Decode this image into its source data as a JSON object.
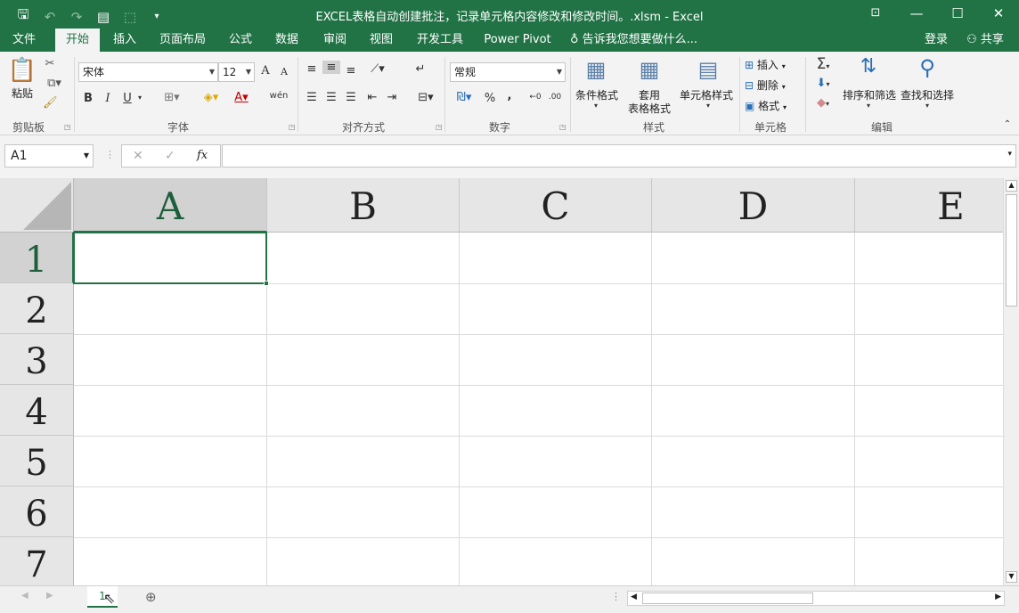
{
  "window": {
    "title": "EXCEL表格自动创建批注，记录单元格内容修改和修改时间。.xlsm - Excel",
    "save_icon": "save-icon",
    "undo_icon": "undo-icon",
    "redo_icon": "redo-icon",
    "ribbon_display_icon": "ribbon-display-icon",
    "minimize_icon": "minimize-icon",
    "maximize_icon": "maximize-icon",
    "close_icon": "close-icon"
  },
  "menu": {
    "tabs": [
      "文件",
      "开始",
      "插入",
      "页面布局",
      "公式",
      "数据",
      "审阅",
      "视图",
      "开发工具",
      "Power Pivot"
    ],
    "active_tab": "开始",
    "tell_me": "告诉我您想要做什么...",
    "login": "登录",
    "share": "共享"
  },
  "ribbon": {
    "clipboard": {
      "paste": "粘贴",
      "group": "剪贴板"
    },
    "font": {
      "name": "宋体",
      "size": "12",
      "bold": "B",
      "italic": "I",
      "underline": "U",
      "phonetic": "wén",
      "group": "字体"
    },
    "alignment": {
      "group": "对齐方式"
    },
    "number": {
      "format": "常规",
      "percent": "%",
      "comma": ",",
      "group": "数字"
    },
    "styles": {
      "conditional": "条件格式",
      "table_line1": "套用",
      "table_line2": "表格格式",
      "cell_styles": "单元格样式",
      "group": "样式"
    },
    "cells": {
      "insert": "插入",
      "delete": "删除",
      "format": "格式",
      "group": "单元格"
    },
    "editing": {
      "sort": "排序和筛选",
      "find": "查找和选择",
      "group": "编辑"
    }
  },
  "formula_bar": {
    "name_box": "A1",
    "cancel": "✕",
    "enter": "✓",
    "fx": "fx",
    "formula": ""
  },
  "grid": {
    "columns": [
      "A",
      "B",
      "C",
      "D",
      "E"
    ],
    "rows": [
      "1",
      "2",
      "3",
      "4",
      "5",
      "6",
      "7"
    ],
    "active_cell": "A1"
  },
  "sheets": {
    "tabs": [
      "1"
    ],
    "active": "1"
  },
  "colors": {
    "accent": "#217346",
    "ribbon_bg": "#f3f3f3",
    "header_bg": "#e6e6e6"
  }
}
